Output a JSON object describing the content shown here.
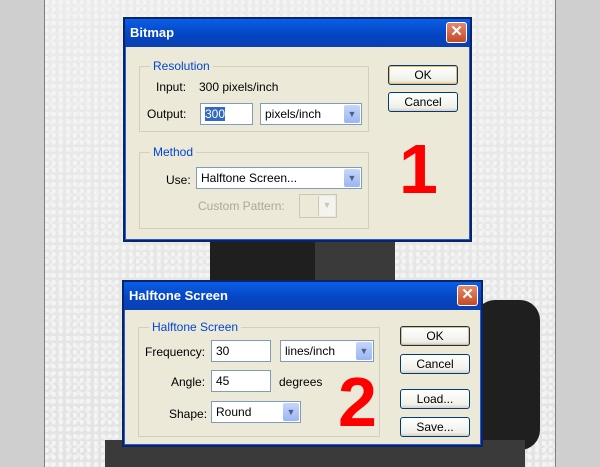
{
  "bitmap_dialog": {
    "title": "Bitmap",
    "close_glyph": "✕",
    "resolution": {
      "group_title": "Resolution",
      "input_label": "Input:",
      "input_value": "300 pixels/inch",
      "output_label": "Output:",
      "output_value": "300",
      "output_unit": "pixels/inch"
    },
    "method": {
      "group_title": "Method",
      "use_label": "Use:",
      "use_value": "Halftone Screen...",
      "custom_pattern_label": "Custom Pattern:"
    },
    "ok_label": "OK",
    "cancel_label": "Cancel",
    "step_number": "1"
  },
  "halftone_dialog": {
    "title": "Halftone Screen",
    "close_glyph": "✕",
    "group_title": "Halftone Screen",
    "frequency_label": "Frequency:",
    "frequency_value": "30",
    "frequency_unit": "lines/inch",
    "angle_label": "Angle:",
    "angle_value": "45",
    "angle_unit": "degrees",
    "shape_label": "Shape:",
    "shape_value": "Round",
    "ok_label": "OK",
    "cancel_label": "Cancel",
    "load_label": "Load...",
    "save_label": "Save...",
    "step_number": "2"
  },
  "colors": {
    "accent_number": "#ff0000",
    "titlebar": "#0546c4",
    "dialog_bg": "#ece9d8",
    "group_title": "#0046d5"
  },
  "icons": {
    "close": "close-icon",
    "dropdown": "chevron-down-icon"
  }
}
